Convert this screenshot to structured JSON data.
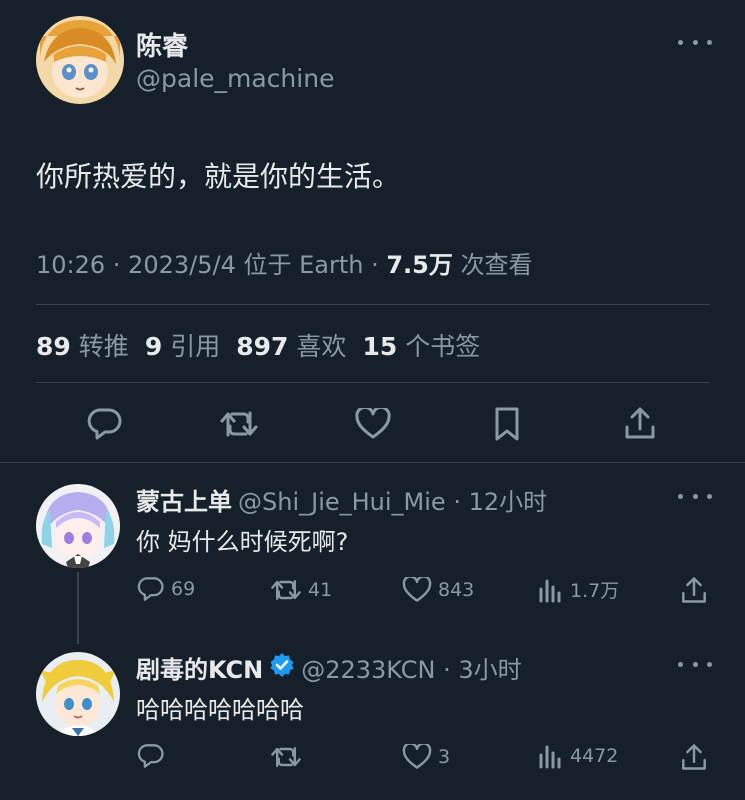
{
  "main_tweet": {
    "display_name": "陈睿",
    "handle": "@pale_machine",
    "text": "你所热爱的，就是你的生活。",
    "time": "10:26 · 2023/5/4 位于 Earth · ",
    "views_count": "7.5万",
    "views_label": " 次查看",
    "stats": [
      {
        "count": "89",
        "label": "转推"
      },
      {
        "count": "9",
        "label": "引用"
      },
      {
        "count": "897",
        "label": "喜欢"
      },
      {
        "count": "15",
        "label": "个书签"
      }
    ]
  },
  "replies": [
    {
      "display_name": "蒙古上单",
      "handle_time": "@Shi_Jie_Hui_Mie · 12小时",
      "text": "你 妈什么时候死啊?",
      "reply_count": "69",
      "retweet_count": "41",
      "like_count": "843",
      "view_count": "1.7万",
      "verified": false
    },
    {
      "display_name": "剧毒的KCN",
      "handle_time": "@2233KCN · 3小时",
      "text": "哈哈哈哈哈哈哈",
      "reply_count": "",
      "retweet_count": "",
      "like_count": "3",
      "view_count": "4472",
      "verified": true
    }
  ],
  "colors": {
    "background": "#15202b",
    "primary_text": "#e7e9ea",
    "secondary_text": "#8b98a5",
    "divider": "#38444d",
    "verified_badge": "#1d9bf0"
  }
}
